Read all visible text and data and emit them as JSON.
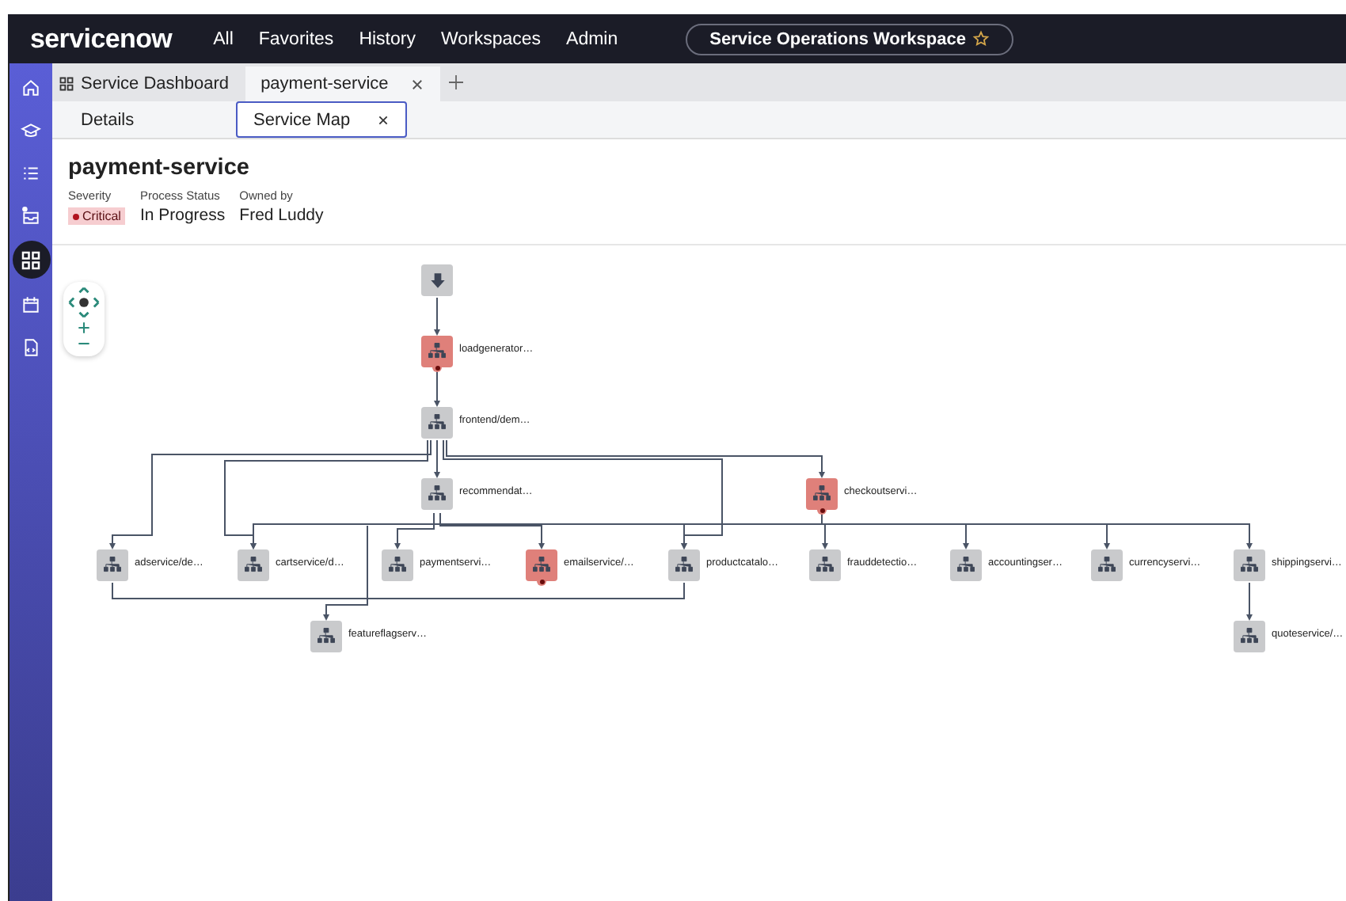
{
  "top_bar": {
    "logo": "servicenow",
    "menu": [
      "All",
      "Favorites",
      "History",
      "Workspaces",
      "Admin"
    ],
    "workspace": "Service Operations Workspace"
  },
  "sidebar": {
    "items": [
      {
        "selected": false
      },
      {
        "selected": false
      },
      {
        "selected": false
      },
      {
        "selected": false
      },
      {
        "selected": true
      },
      {
        "selected": false
      },
      {
        "selected": false
      }
    ]
  },
  "tabs": [
    {
      "label": "Service Dashboard",
      "kind": "dashboard",
      "selected": false
    },
    {
      "label": "payment-service",
      "kind": "record",
      "selected": true
    }
  ],
  "sub_tabs": [
    {
      "label": "Details",
      "selected": false
    },
    {
      "label": "Service Map",
      "selected": true
    }
  ],
  "record": {
    "title": "payment-service",
    "fields": [
      {
        "label": "Severity",
        "value": "Critical",
        "kind": "badge"
      },
      {
        "label": "Process Status",
        "value": "In Progress",
        "kind": "text"
      },
      {
        "label": "Owned by",
        "value": "Fred Luddy",
        "kind": "text"
      }
    ]
  },
  "service_map": {
    "nodes": [
      {
        "kind": "entry"
      },
      {
        "kind": "service",
        "label": "loadgenerator…",
        "alert": true
      },
      {
        "kind": "service",
        "label": "frontend/dem…",
        "alert": false
      },
      {
        "kind": "service",
        "label": "recommendat…",
        "alert": false
      },
      {
        "kind": "service",
        "label": "checkoutservi…",
        "alert": true
      },
      {
        "kind": "service",
        "label": "adservice/de…",
        "alert": false
      },
      {
        "kind": "service",
        "label": "cartservice/d…",
        "alert": false
      },
      {
        "kind": "service",
        "label": "paymentservi…",
        "alert": false
      },
      {
        "kind": "service",
        "label": "emailservice/…",
        "alert": true
      },
      {
        "kind": "service",
        "label": "productcatalo…",
        "alert": false
      },
      {
        "kind": "service",
        "label": "frauddetectio…",
        "alert": false
      },
      {
        "kind": "service",
        "label": "accountingser…",
        "alert": false
      },
      {
        "kind": "service",
        "label": "currencyservi…",
        "alert": false
      },
      {
        "kind": "service",
        "label": "shippingservi…",
        "alert": false
      },
      {
        "kind": "service",
        "label": "featureflagserv…",
        "alert": false
      },
      {
        "kind": "service",
        "label": "quoteservice/…",
        "alert": false
      }
    ]
  }
}
